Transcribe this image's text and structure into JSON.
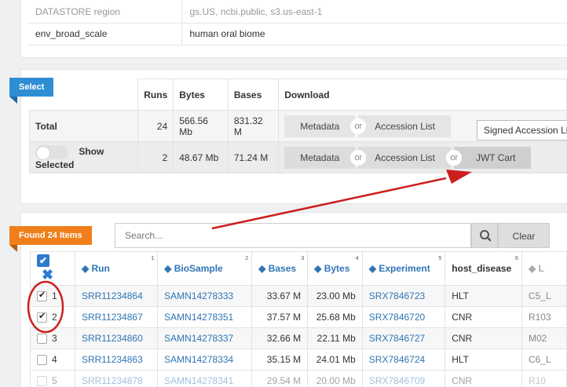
{
  "meta": {
    "rows": [
      {
        "key": "DATASTORE region",
        "value": "gs.US, ncbi.public, s3.us-east-1"
      },
      {
        "key": "env_broad_scale",
        "value": "human oral biome"
      }
    ]
  },
  "select_panel": {
    "ribbon": "Select",
    "headers": {
      "runs": "Runs",
      "bytes": "Bytes",
      "bases": "Bases",
      "download": "Download"
    },
    "total": {
      "label": "Total",
      "runs": "24",
      "bytes": "566.56 Mb",
      "bases": "831.32 M"
    },
    "selected": {
      "label": "Show Selected",
      "runs": "2",
      "bytes": "48.67 Mb",
      "bases": "71.24 M"
    },
    "metadata_label": "Metadata",
    "accession_label": "Accession List",
    "or_label": "or",
    "jwt_label": "JWT Cart",
    "signed_select_value": "Signed Accession Lis"
  },
  "found_panel": {
    "ribbon": "Found 24 Items",
    "search_placeholder": "Search...",
    "clear_label": "Clear",
    "columns": [
      {
        "label": "Run",
        "index": "1"
      },
      {
        "label": "BioSample",
        "index": "2"
      },
      {
        "label": "Bases",
        "index": "3"
      },
      {
        "label": "Bytes",
        "index": "4"
      },
      {
        "label": "Experiment",
        "index": "5"
      },
      {
        "label": "host_disease",
        "index": "6"
      },
      {
        "label": "L",
        "index": ""
      }
    ],
    "rows": [
      {
        "n": "1",
        "checked": true,
        "run": "SRR11234864",
        "biosample": "SAMN14278333",
        "bases": "33.67 M",
        "bytes": "23.00 Mb",
        "experiment": "SRX7846723",
        "host_disease": "HLT",
        "extra": "C5_L"
      },
      {
        "n": "2",
        "checked": true,
        "run": "SRR11234867",
        "biosample": "SAMN14278351",
        "bases": "37.57 M",
        "bytes": "25.68 Mb",
        "experiment": "SRX7846720",
        "host_disease": "CNR",
        "extra": "R103"
      },
      {
        "n": "3",
        "checked": false,
        "run": "SRR11234860",
        "biosample": "SAMN14278337",
        "bases": "32.66 M",
        "bytes": "22.11 Mb",
        "experiment": "SRX7846727",
        "host_disease": "CNR",
        "extra": "M02"
      },
      {
        "n": "4",
        "checked": false,
        "run": "SRR11234863",
        "biosample": "SAMN14278334",
        "bases": "35.15 M",
        "bytes": "24.01 Mb",
        "experiment": "SRX7846724",
        "host_disease": "HLT",
        "extra": "C6_L"
      },
      {
        "n": "5",
        "checked": false,
        "run": "SRR11234878",
        "biosample": "SAMN14278341",
        "bases": "29.54 M",
        "bytes": "20.00 Mb",
        "experiment": "SRX7846709",
        "host_disease": "CNR",
        "extra": "R10"
      }
    ]
  },
  "colors": {
    "link": "#2f75b5",
    "accent_blue": "#2e8ed4",
    "accent_orange": "#f07f1b",
    "annotation_red": "#cc1f1f"
  }
}
